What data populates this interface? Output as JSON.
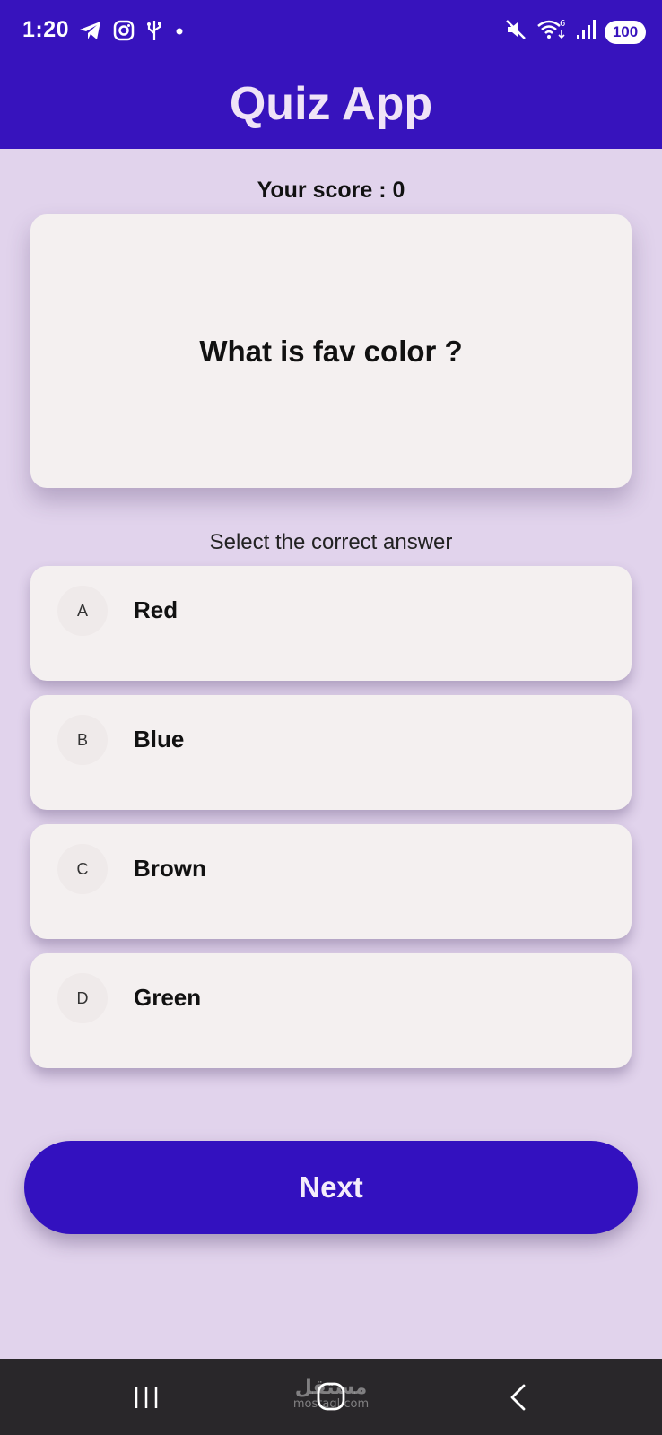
{
  "status_bar": {
    "time": "1:20",
    "left_icons": [
      "telegram-icon",
      "instagram-icon",
      "usb-icon",
      "notification-dot-icon"
    ],
    "right_icons": [
      "mute-icon",
      "wifi-icon",
      "signal-icon"
    ],
    "wifi_badge": "6",
    "battery": "100"
  },
  "app_bar": {
    "title": "Quiz App",
    "color": "#3713bd"
  },
  "score": {
    "text": "Your score : 0"
  },
  "question": {
    "text": "What is fav color ?"
  },
  "instruction": "Select the correct answer",
  "options": [
    {
      "letter": "A",
      "label": "Red"
    },
    {
      "letter": "B",
      "label": "Blue"
    },
    {
      "letter": "C",
      "label": "Brown"
    },
    {
      "letter": "D",
      "label": "Green"
    }
  ],
  "next_button": {
    "label": "Next"
  },
  "nav_bar": {
    "buttons": [
      "recents-icon",
      "home-icon",
      "back-icon"
    ],
    "watermark_arabic": "مستقل",
    "watermark_latin": "mostaql.com"
  },
  "colors": {
    "background": "#e1d3ec",
    "primary": "#3311bf",
    "card": "#f4f0f0"
  }
}
